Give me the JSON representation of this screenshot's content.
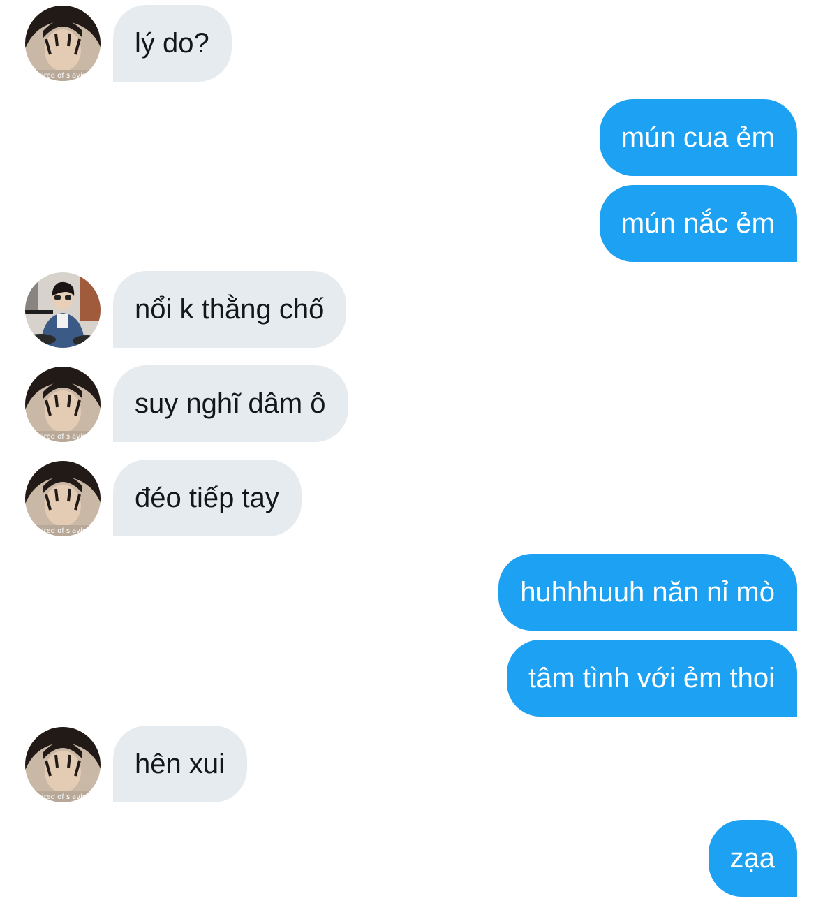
{
  "conversation": {
    "messages": [
      {
        "text": "lý do?",
        "sender": "other"
      },
      {
        "text": "mún cua ẻm",
        "sender": "me"
      },
      {
        "text": "mún nắc ẻm",
        "sender": "me"
      },
      {
        "text": "nổi k thằng chố",
        "sender": "other"
      },
      {
        "text": "suy nghĩ dâm ô",
        "sender": "other"
      },
      {
        "text": "đéo tiếp tay",
        "sender": "other"
      },
      {
        "text": "huhhhuuh năn nỉ mò",
        "sender": "me"
      },
      {
        "text": "tâm tình với ẻm thoi",
        "sender": "me"
      },
      {
        "text": "hên xui",
        "sender": "other"
      },
      {
        "text": "zạa",
        "sender": "me"
      }
    ]
  },
  "colors": {
    "incoming_bubble": "#e6ebef",
    "incoming_text": "#14171a",
    "outgoing_bubble": "#1da1f2",
    "outgoing_text": "#ffffff"
  },
  "avatars": {
    "primary": {
      "icon": "person-avatar-icon",
      "caption": "tired of slavin"
    },
    "secondary": {
      "icon": "person-drummer-avatar-icon"
    }
  }
}
